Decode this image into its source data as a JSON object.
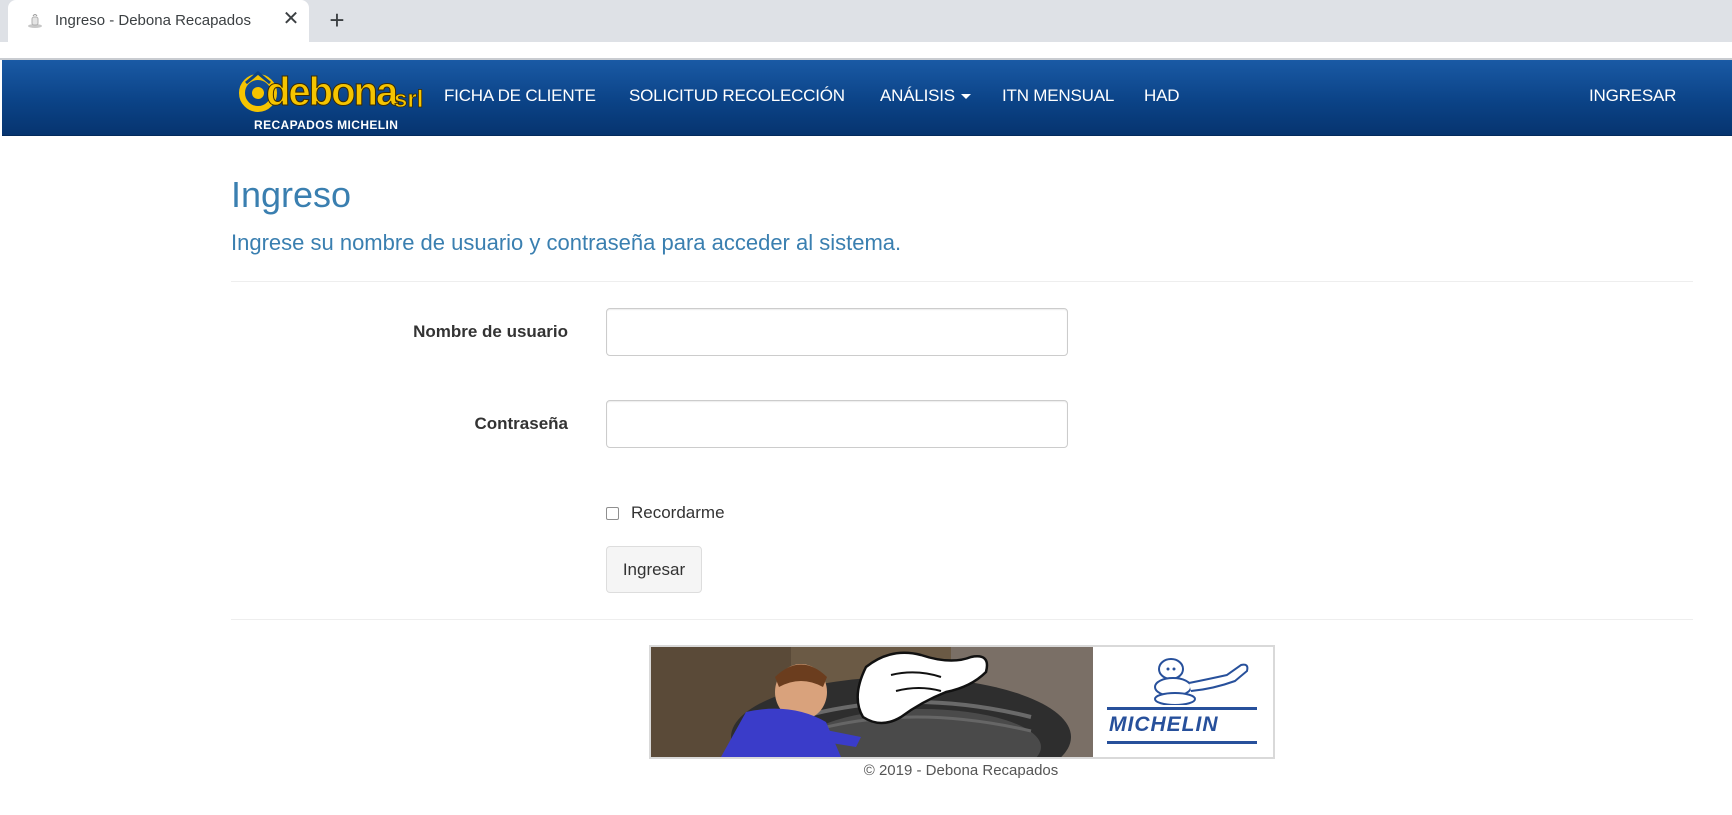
{
  "browser": {
    "tab_title": "Ingreso - Debona Recapados",
    "close_glyph": "✕",
    "new_tab_glyph": "+"
  },
  "navbar": {
    "logo_text": "debona",
    "logo_suffix": "srl",
    "logo_subtitle": "RECAPADOS MICHELIN",
    "links": [
      {
        "label": "FICHA DE CLIENTE"
      },
      {
        "label": "SOLICITUD RECOLECCIÓN"
      },
      {
        "label": "ANÁLISIS"
      },
      {
        "label": "ITN MENSUAL"
      },
      {
        "label": "HAD"
      }
    ],
    "login_link": "INGRESAR",
    "colors": {
      "bar": "#0b4387",
      "logo_yellow": "#f5c400"
    }
  },
  "main": {
    "title": "Ingreso",
    "subtitle": "Ingrese su nombre de usuario y contraseña para acceder al sistema.",
    "form": {
      "username_label": "Nombre de usuario",
      "username_value": "",
      "password_label": "Contraseña",
      "password_value": "",
      "remember_label": "Recordarme",
      "remember_checked": false,
      "submit_label": "Ingresar"
    },
    "accent_color": "#3a7fb0"
  },
  "banner": {
    "brand": "MICHELIN"
  },
  "footer": {
    "copyright": "© 2019 - Debona Recapados"
  }
}
